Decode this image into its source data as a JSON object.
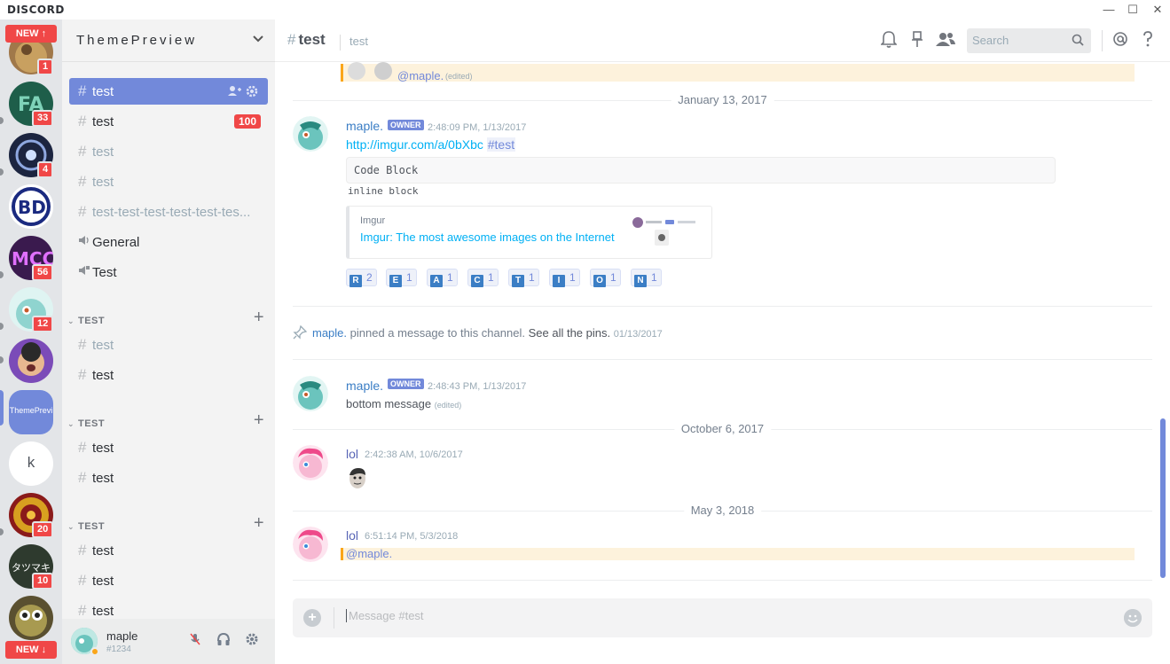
{
  "app": {
    "logo": "DISCORD",
    "window_controls": [
      "—",
      "☐",
      "✕"
    ]
  },
  "guilds": {
    "new_top": "NEW ↑",
    "new_bottom": "NEW ↓",
    "items": [
      {
        "badge": "1",
        "color": "#a0784a"
      },
      {
        "badge": "33",
        "color": "#1e5e4a"
      },
      {
        "badge": "4",
        "color": "#2b3a5c"
      },
      {
        "badge": "",
        "color": "#ffffff",
        "label": "BD"
      },
      {
        "badge": "56",
        "color": "#5b2a6e"
      },
      {
        "badge": "12",
        "color": "#8fd4cf"
      },
      {
        "badge": "",
        "color": "#7b4bb8"
      },
      {
        "badge": "",
        "color": "#7289da",
        "label": "ThemePrevi"
      },
      {
        "badge": "",
        "color": "#ffffff",
        "label": "k"
      },
      {
        "badge": "20",
        "color": "#c28a12"
      },
      {
        "badge": "10",
        "color": "#2e3a2e",
        "label": "タツマキ"
      },
      {
        "badge": "",
        "color": "#8a7a3a"
      }
    ]
  },
  "server": {
    "name": "ThemePreview",
    "chevron": "⌄"
  },
  "channels": {
    "top": [
      {
        "name": "test",
        "state": "active",
        "badge": ""
      },
      {
        "name": "test",
        "state": "unread",
        "badge": "100"
      },
      {
        "name": "test",
        "state": "muted",
        "badge": ""
      },
      {
        "name": "test",
        "state": "muted",
        "badge": ""
      },
      {
        "name": "test-test-test-test-test-tes...",
        "state": "muted",
        "badge": ""
      }
    ],
    "voice": [
      {
        "name": "General",
        "locked": false
      },
      {
        "name": "Test",
        "locked": true
      }
    ],
    "categories": [
      {
        "name": "TEST",
        "items": [
          {
            "name": "test",
            "state": "muted"
          },
          {
            "name": "test",
            "state": "unread"
          }
        ]
      },
      {
        "name": "TEST",
        "items": [
          {
            "name": "test",
            "state": "unread"
          },
          {
            "name": "test",
            "state": "unread"
          }
        ]
      },
      {
        "name": "TEST",
        "items": [
          {
            "name": "test",
            "state": "unread"
          },
          {
            "name": "test",
            "state": "unread"
          },
          {
            "name": "test",
            "state": "unread"
          }
        ]
      }
    ]
  },
  "user": {
    "name": "maple",
    "discriminator": "#1234"
  },
  "header": {
    "channel": "test",
    "hash": "#",
    "topic": "test",
    "search_placeholder": "Search"
  },
  "messages": {
    "top_mention": "@maple.",
    "top_edited": "(edited)",
    "date1": "January 13, 2017",
    "m1": {
      "author": "maple.",
      "badge": "OWNER",
      "time": "2:48:09 PM, 1/13/2017",
      "link": "http://imgur.com/a/0bXbc",
      "channel_mention": "#test",
      "code_block": "Code Block",
      "inline_block": "inline block",
      "embed_provider": "Imgur",
      "embed_title": "Imgur: The most awesome images on the Internet",
      "reactions": [
        {
          "letter": "R",
          "count": "2"
        },
        {
          "letter": "E",
          "count": "1"
        },
        {
          "letter": "A",
          "count": "1"
        },
        {
          "letter": "C",
          "count": "1"
        },
        {
          "letter": "T",
          "count": "1"
        },
        {
          "letter": "I",
          "count": "1"
        },
        {
          "letter": "O",
          "count": "1"
        },
        {
          "letter": "N",
          "count": "1"
        }
      ]
    },
    "pin": {
      "author": "maple.",
      "text": "pinned a message to this channel.",
      "link": "See all the pins.",
      "date": "01/13/2017"
    },
    "m2": {
      "author": "maple.",
      "badge": "OWNER",
      "time": "2:48:43 PM, 1/13/2017",
      "text": "bottom message",
      "edited": "(edited)"
    },
    "date2": "October 6, 2017",
    "m3": {
      "author": "lol",
      "time": "2:42:38 AM, 10/6/2017"
    },
    "date3": "May 3, 2018",
    "m4": {
      "author": "lol",
      "time": "6:51:14 PM, 5/3/2018",
      "mention": "@maple."
    }
  },
  "composer": {
    "placeholder": "Message #test"
  },
  "colors": {
    "accent": "#7289da",
    "badge_red": "#f04747",
    "link": "#00b0f4",
    "owner_author": "#3b7ec5",
    "lol_author": "#5865b6"
  }
}
